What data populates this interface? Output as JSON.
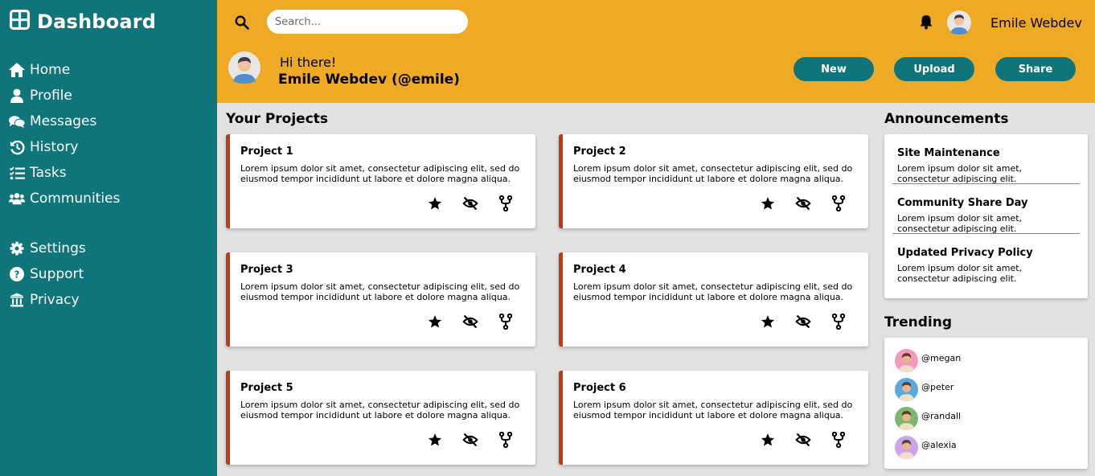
{
  "sidebar": {
    "title": "Dashboard",
    "nav_primary": [
      {
        "label": "Home",
        "icon": "home-icon"
      },
      {
        "label": "Profile",
        "icon": "user-icon"
      },
      {
        "label": "Messages",
        "icon": "chat-icon"
      },
      {
        "label": "History",
        "icon": "history-icon"
      },
      {
        "label": "Tasks",
        "icon": "tasks-icon"
      },
      {
        "label": "Communities",
        "icon": "people-icon"
      }
    ],
    "nav_secondary": [
      {
        "label": "Settings",
        "icon": "gear-icon"
      },
      {
        "label": "Support",
        "icon": "help-icon"
      },
      {
        "label": "Privacy",
        "icon": "privacy-icon"
      }
    ]
  },
  "header": {
    "search_placeholder": "Search...",
    "username": "Emile Webdev",
    "greeting": "Hi there!",
    "display_name": "Emile Webdev (@emile)",
    "buttons": {
      "new": "New",
      "upload": "Upload",
      "share": "Share"
    }
  },
  "projects": {
    "title": "Your Projects",
    "items": [
      {
        "name": "Project 1",
        "desc": "Lorem ipsum dolor sit amet, consectetur adipiscing elit, sed do eiusmod tempor incididunt ut labore et dolore magna aliqua."
      },
      {
        "name": "Project 2",
        "desc": "Lorem ipsum dolor sit amet, consectetur adipiscing elit, sed do eiusmod tempor incididunt ut labore et dolore magna aliqua."
      },
      {
        "name": "Project 3",
        "desc": "Lorem ipsum dolor sit amet, consectetur adipiscing elit, sed do eiusmod tempor incididunt ut labore et dolore magna aliqua."
      },
      {
        "name": "Project 4",
        "desc": "Lorem ipsum dolor sit amet, consectetur adipiscing elit, sed do eiusmod tempor incididunt ut labore et dolore magna aliqua."
      },
      {
        "name": "Project 5",
        "desc": "Lorem ipsum dolor sit amet, consectetur adipiscing elit, sed do eiusmod tempor incididunt ut labore et dolore magna aliqua."
      },
      {
        "name": "Project 6",
        "desc": "Lorem ipsum dolor sit amet, consectetur adipiscing elit, sed do eiusmod tempor incididunt ut labore et dolore magna aliqua."
      }
    ]
  },
  "announcements": {
    "title": "Announcements",
    "items": [
      {
        "title": "Site Maintenance",
        "desc": "Lorem ipsum dolor sit amet, consectetur adipiscing elit."
      },
      {
        "title": "Community Share Day",
        "desc": "Lorem ipsum dolor sit amet, consectetur adipiscing elit."
      },
      {
        "title": "Updated Privacy Policy",
        "desc": "Lorem ipsum dolor sit amet, consectetur adipiscing elit."
      }
    ]
  },
  "trending": {
    "title": "Trending",
    "users": [
      {
        "handle": "@megan",
        "bg": "#f49ac1"
      },
      {
        "handle": "@peter",
        "bg": "#5aa9e0"
      },
      {
        "handle": "@randall",
        "bg": "#7cb870"
      },
      {
        "handle": "@alexia",
        "bg": "#c9a6e8"
      }
    ]
  },
  "colors": {
    "sidebar": "#10757a",
    "header": "#eeaa25",
    "accent": "#c03a12",
    "background": "#e2e2e2"
  }
}
